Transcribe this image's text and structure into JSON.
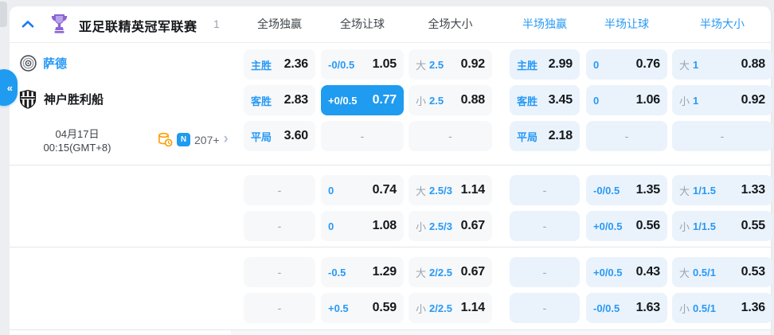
{
  "colors": {
    "accent_blue": "#1f9bf0",
    "label_blue": "#2899f5",
    "full_cell_bg": "#f6f8fa",
    "half_cell_bg": "#eaf3fc",
    "page_bg": "#eceef1"
  },
  "header": {
    "league": "亚足联精英冠军联赛",
    "match_count": "1",
    "columns": [
      {
        "label": "全场独赢",
        "scope": "full"
      },
      {
        "label": "全场让球",
        "scope": "full"
      },
      {
        "label": "全场大小",
        "scope": "full"
      },
      {
        "label": "半场独赢",
        "scope": "half"
      },
      {
        "label": "半场让球",
        "scope": "half"
      },
      {
        "label": "半场大小",
        "scope": "half"
      }
    ]
  },
  "match": {
    "home_team": "萨德",
    "away_team": "神户胜利船",
    "date": "04月17日",
    "time": "00:15(GMT+8)",
    "n_badge": "N",
    "markets_count": "207+",
    "expand_tab": "«"
  },
  "odds": {
    "rows": [
      [
        {
          "blue": "主胜",
          "odds": "2.36"
        },
        {
          "blue": "-0/0.5",
          "odds": "1.05"
        },
        {
          "gray": "大",
          "blue": "2.5",
          "odds": "0.92"
        },
        {
          "blue": "主胜",
          "odds": "2.99"
        },
        {
          "blue": "0",
          "odds": "0.76"
        },
        {
          "gray": "大",
          "blue": "1",
          "odds": "0.88"
        }
      ],
      [
        {
          "blue": "客胜",
          "odds": "2.83"
        },
        {
          "blue": "+0/0.5",
          "odds": "0.77",
          "selected": true
        },
        {
          "gray": "小",
          "blue": "2.5",
          "odds": "0.88"
        },
        {
          "blue": "客胜",
          "odds": "3.45"
        },
        {
          "blue": "0",
          "odds": "1.06"
        },
        {
          "gray": "小",
          "blue": "1",
          "odds": "0.92"
        }
      ],
      [
        {
          "blue": "平局",
          "odds": "3.60"
        },
        {
          "dash": true
        },
        {
          "dash": true
        },
        {
          "blue": "平局",
          "odds": "2.18"
        },
        {
          "dash": true
        },
        {
          "dash": true
        }
      ],
      [
        {
          "dash": true
        },
        {
          "blue": "0",
          "odds": "0.74"
        },
        {
          "gray": "大",
          "blue": "2.5/3",
          "odds": "1.14"
        },
        {
          "dash": true
        },
        {
          "blue": "-0/0.5",
          "odds": "1.35"
        },
        {
          "gray": "大",
          "blue": "1/1.5",
          "odds": "1.33"
        }
      ],
      [
        {
          "dash": true
        },
        {
          "blue": "0",
          "odds": "1.08"
        },
        {
          "gray": "小",
          "blue": "2.5/3",
          "odds": "0.67"
        },
        {
          "dash": true
        },
        {
          "blue": "+0/0.5",
          "odds": "0.56"
        },
        {
          "gray": "小",
          "blue": "1/1.5",
          "odds": "0.55"
        }
      ],
      [
        {
          "dash": true
        },
        {
          "blue": "-0.5",
          "odds": "1.29"
        },
        {
          "gray": "大",
          "blue": "2/2.5",
          "odds": "0.67"
        },
        {
          "dash": true
        },
        {
          "blue": "+0/0.5",
          "odds": "0.43"
        },
        {
          "gray": "大",
          "blue": "0.5/1",
          "odds": "0.53"
        }
      ],
      [
        {
          "dash": true
        },
        {
          "blue": "+0.5",
          "odds": "0.59"
        },
        {
          "gray": "小",
          "blue": "2/2.5",
          "odds": "1.14"
        },
        {
          "dash": true
        },
        {
          "blue": "-0/0.5",
          "odds": "1.63"
        },
        {
          "gray": "小",
          "blue": "0.5/1",
          "odds": "1.36"
        }
      ]
    ]
  }
}
